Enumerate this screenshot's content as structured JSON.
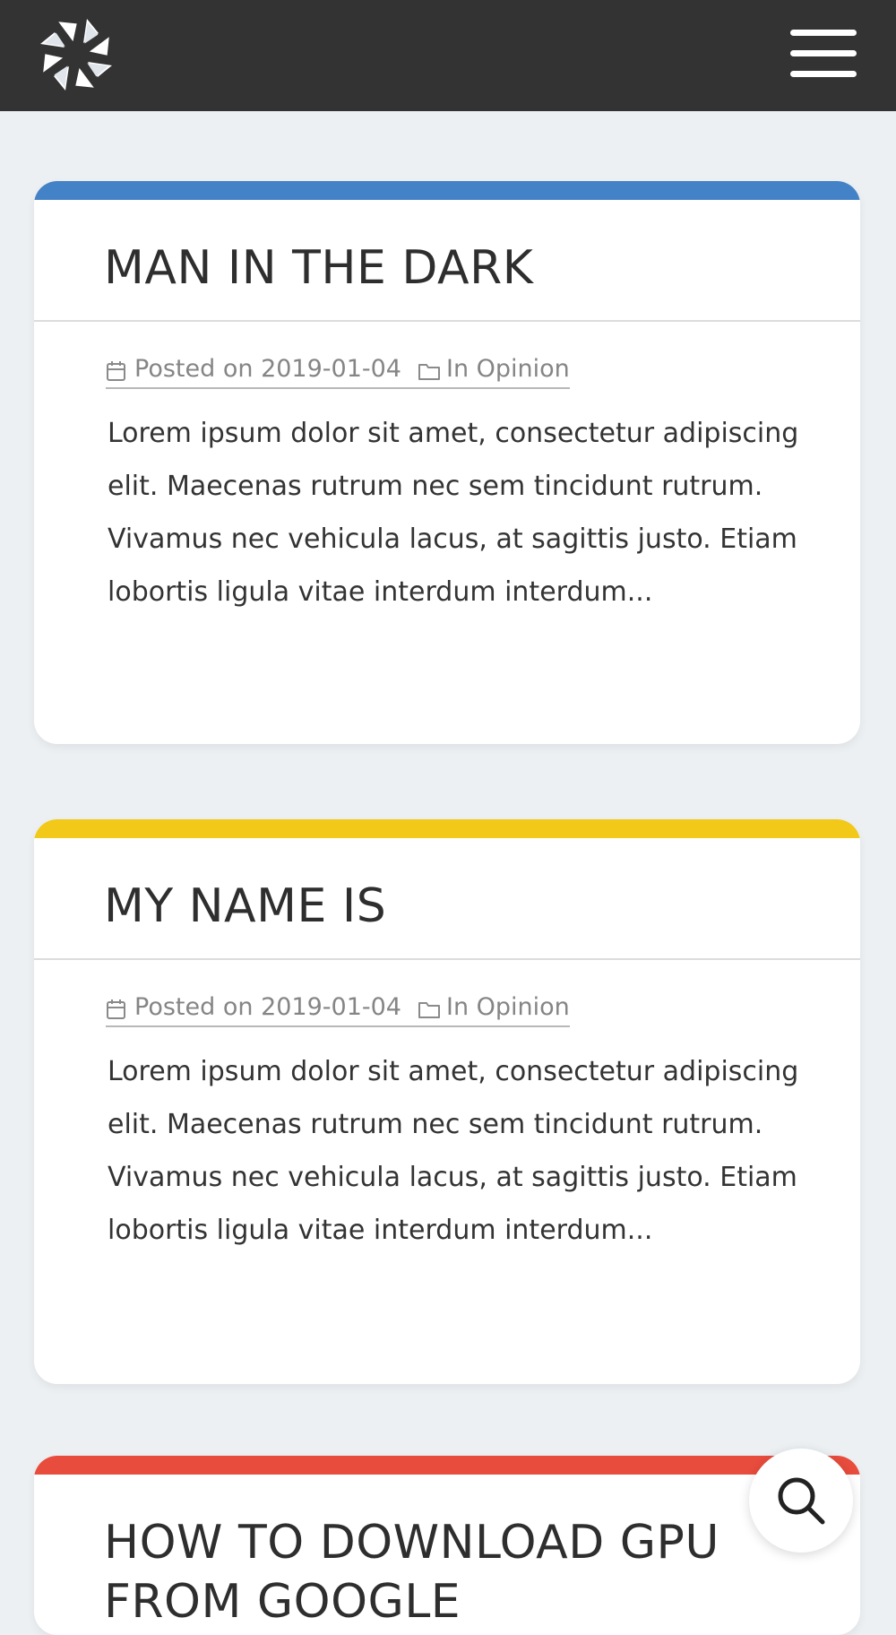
{
  "header": {
    "logo_icon": "sunburst-logo-icon",
    "menu_icon": "hamburger-menu-icon",
    "background": "#333333"
  },
  "posts": [
    {
      "title": "MAN IN THE DARK",
      "accent": "#4482c7",
      "posted_prefix": "Posted on",
      "date": "2019-01-04",
      "category_prefix": "In",
      "category": "Opinion",
      "excerpt": "Lorem ipsum dolor sit amet, consectetur adipiscing elit. Maecenas rutrum nec sem tincidunt rutrum. Vivamus nec vehicula lacus, at sagittis justo. Etiam lobortis ligula vitae interdum interdum..."
    },
    {
      "title": "MY NAME IS",
      "accent": "#f2c819",
      "posted_prefix": "Posted on",
      "date": "2019-01-04",
      "category_prefix": "In",
      "category": "Opinion",
      "excerpt": "Lorem ipsum dolor sit amet, consectetur adipiscing elit. Maecenas rutrum nec sem tincidunt rutrum. Vivamus nec vehicula lacus, at sagittis justo. Etiam lobortis ligula vitae interdum interdum..."
    },
    {
      "title": "HOW TO DOWNLOAD GPU FROM GOOGLE",
      "accent": "#e84c3d"
    }
  ],
  "search_fab": {
    "icon": "search-icon"
  }
}
